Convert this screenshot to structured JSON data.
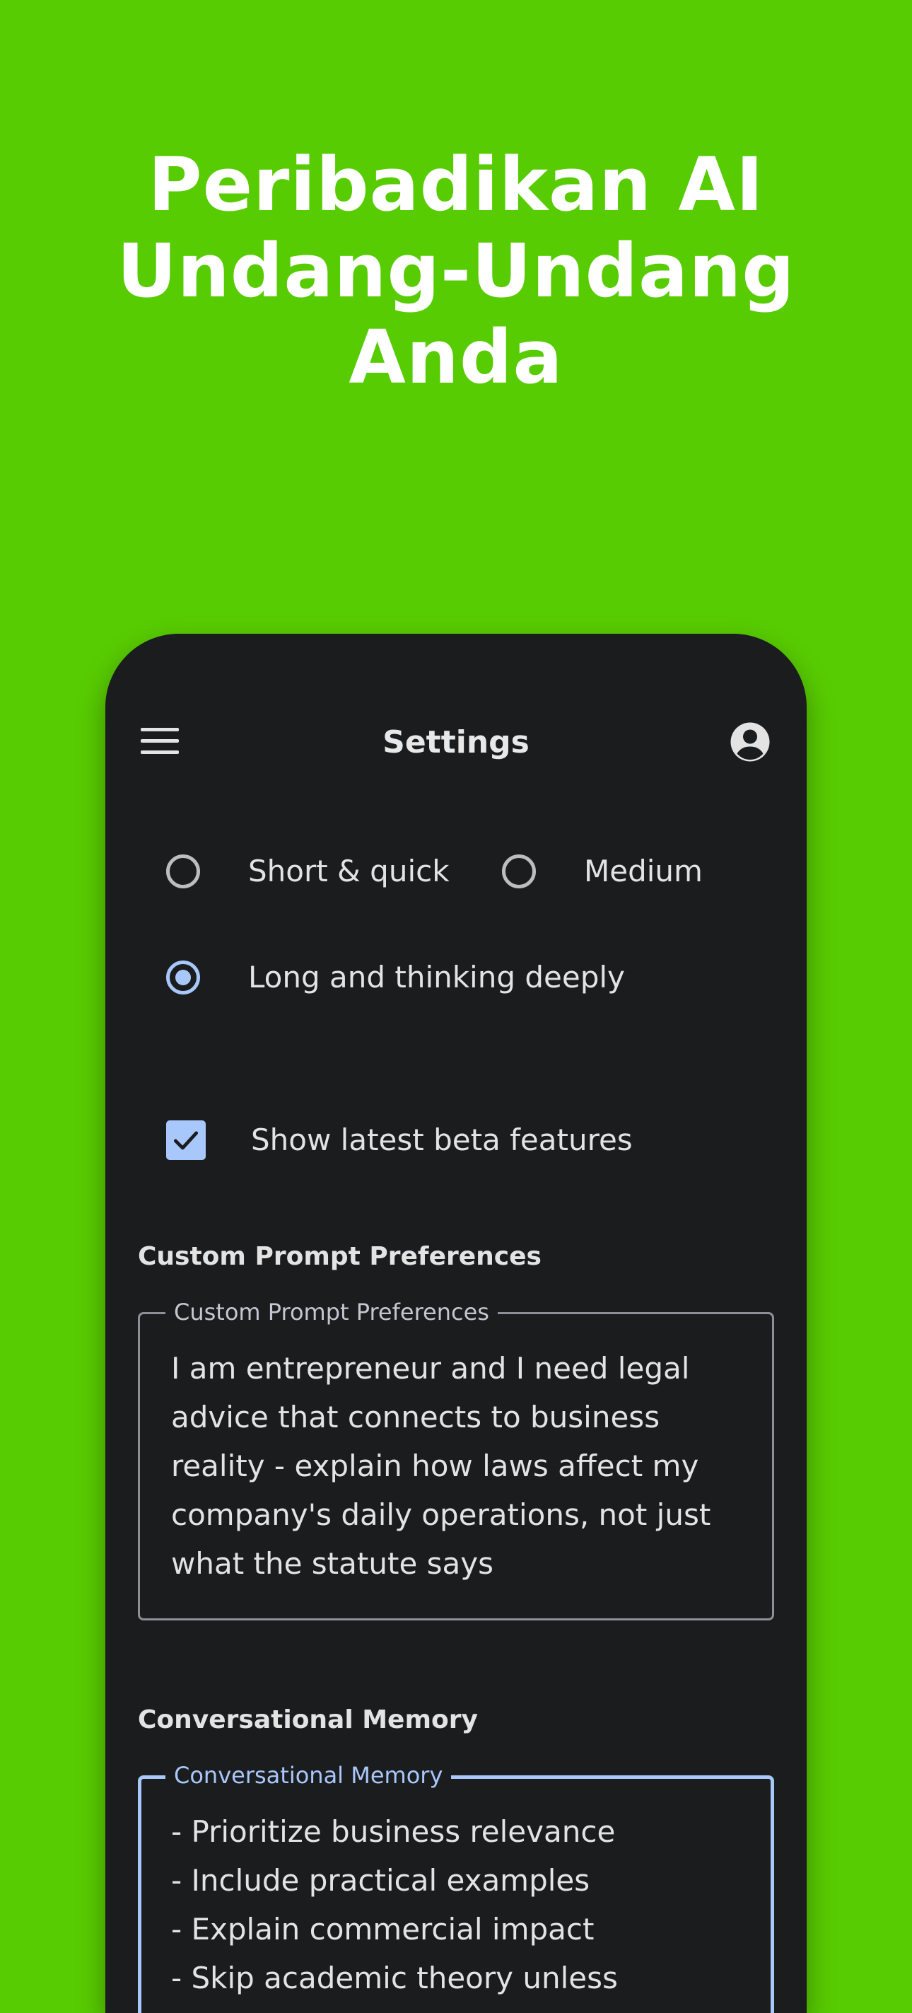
{
  "headline": {
    "line1": "Peribadikan AI",
    "line2": "Undang-Undang",
    "line3": "Anda"
  },
  "appbar": {
    "title": "Settings",
    "menu_icon": "menu-icon",
    "account_icon": "account-circle-icon"
  },
  "response_length": {
    "options": [
      {
        "label": "Short & quick",
        "selected": false
      },
      {
        "label": "Medium",
        "selected": false
      },
      {
        "label": "Long and thinking deeply",
        "selected": true
      }
    ]
  },
  "beta": {
    "label": "Show latest beta features",
    "checked": true
  },
  "custom_prompt": {
    "section_title": "Custom Prompt Preferences",
    "field_label": "Custom Prompt Preferences",
    "value": "I am entrepreneur and I  need legal advice that connects to business reality - explain how laws affect my company's daily operations, not just what the statute says"
  },
  "memory": {
    "section_title": "Conversational Memory",
    "field_label": "Conversational Memory",
    "value": "- Prioritize business relevance\n- Include practical examples\n- Explain commercial impact\n- Skip academic theory unless"
  },
  "colors": {
    "background": "#58cc02",
    "phone_surface": "#1b1c1e",
    "accent": "#a8c7fa",
    "text": "#e3e3e3"
  }
}
